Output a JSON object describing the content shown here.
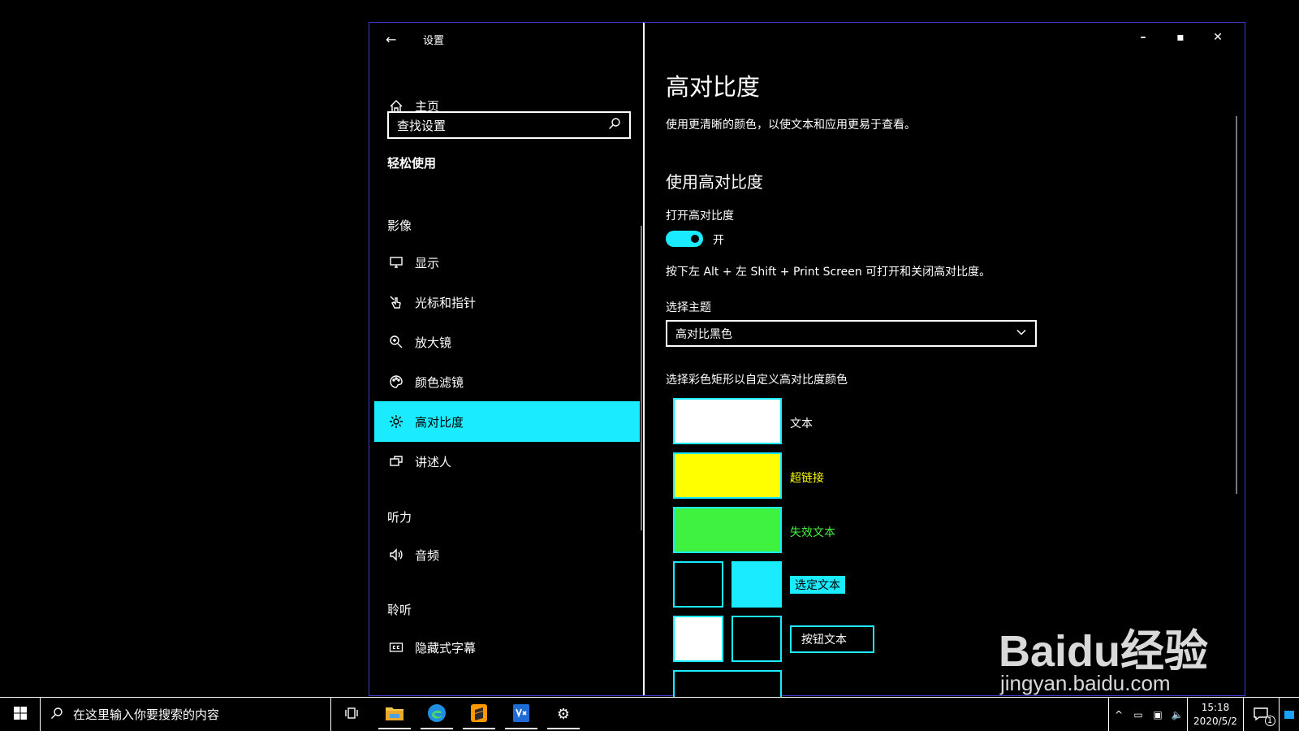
{
  "window": {
    "title": "设置"
  },
  "nav": {
    "home": "主页",
    "search_placeholder": "查找设置",
    "category": "轻松使用",
    "groups": [
      {
        "label": "影像",
        "items": [
          "显示",
          "光标和指针",
          "放大镜",
          "颜色滤镜",
          "高对比度",
          "讲述人"
        ]
      },
      {
        "label": "听力",
        "items": [
          "音频"
        ]
      },
      {
        "label": "聆听",
        "items": [
          "隐藏式字幕"
        ]
      }
    ],
    "selected": "高对比度"
  },
  "content": {
    "title": "高对比度",
    "description": "使用更清晰的颜色，以使文本和应用更易于查看。",
    "section": "使用高对比度",
    "toggle_label": "打开高对比度",
    "toggle_state": "开",
    "shortcut_hint": "按下左 Alt + 左 Shift + Print Screen 可打开和关闭高对比度。",
    "theme_label": "选择主题",
    "theme_value": "高对比黑色",
    "custom_label": "选择彩色矩形以自定义高对比度颜色",
    "swatches": {
      "text": "文本",
      "hyperlink": "超链接",
      "disabled": "失效文本",
      "selected": "选定文本",
      "button": "按钮文本"
    }
  },
  "colors": {
    "accent": "#1aebff",
    "text": "#ffffff",
    "hyperlink": "#ffff00",
    "disabled": "#3ff23f",
    "background": "#000000"
  },
  "taskbar": {
    "search_placeholder": "在这里输入你要搜索的内容",
    "time": "15:18",
    "date": "2020/5/2",
    "notifications": "1"
  },
  "watermark": {
    "logo": "Baidu经验",
    "url": "jingyan.baidu.com"
  }
}
